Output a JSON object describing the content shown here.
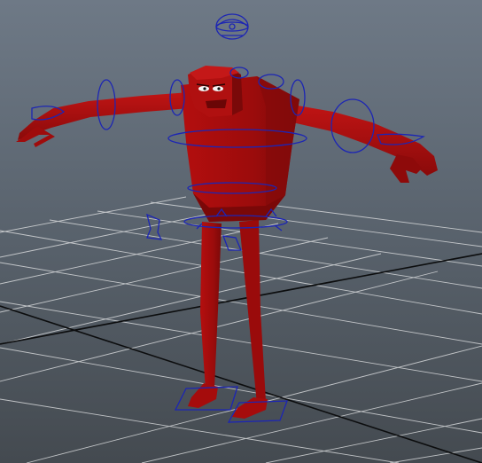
{
  "viewport": {
    "background_top": "#6e7986",
    "background_bottom": "#444a50"
  },
  "scene": {
    "character": {
      "name": "red-character-model",
      "color": "#a80d0d"
    },
    "grid": {
      "line_color": "#d6d8da",
      "axis_color": "#0c0d0e"
    },
    "rig_controls": {
      "color": "#1c25b4"
    }
  }
}
